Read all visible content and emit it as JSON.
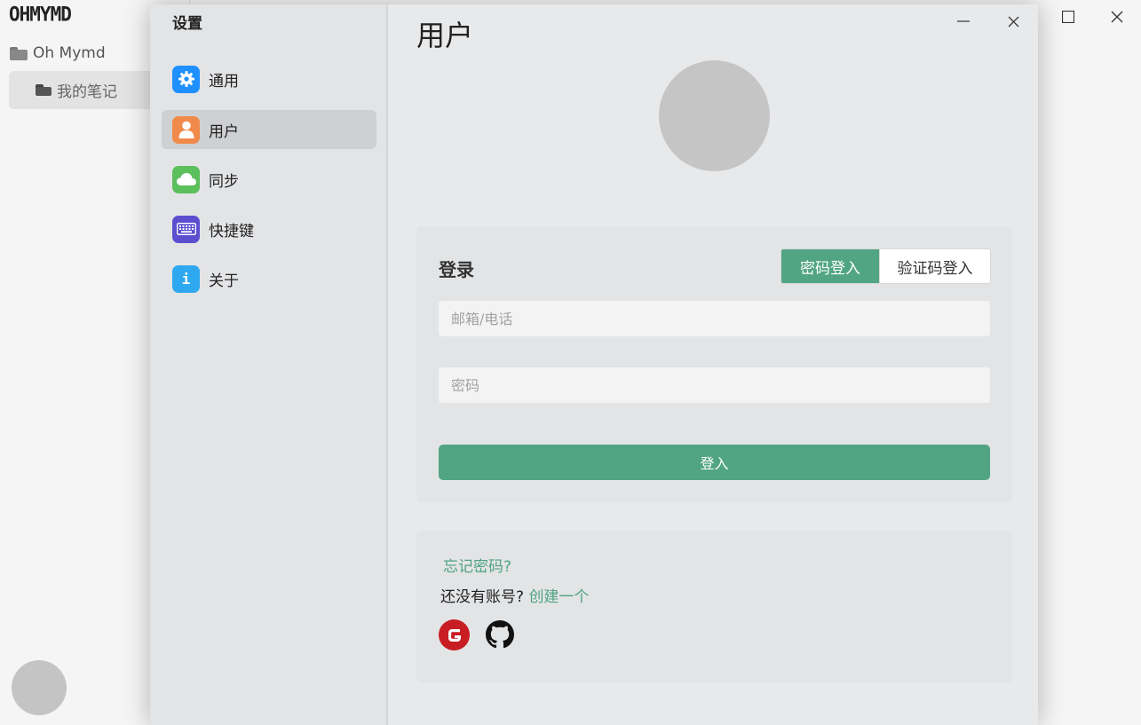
{
  "app": {
    "logo": "OHMYMD",
    "tree": {
      "root_label": "Oh Mymd",
      "child_label": "我的笔记"
    }
  },
  "dialog": {
    "title": "设置",
    "nav": [
      {
        "label": "通用",
        "icon": "gear-icon",
        "color": "#1e90ff"
      },
      {
        "label": "用户",
        "icon": "user-icon",
        "color": "#f08a4b"
      },
      {
        "label": "同步",
        "icon": "cloud-icon",
        "color": "#5bbf5b"
      },
      {
        "label": "快捷键",
        "icon": "keyboard-icon",
        "color": "#5b4fd0"
      },
      {
        "label": "关于",
        "icon": "info-icon",
        "color": "#2ea8f0"
      }
    ],
    "active_nav": "用户"
  },
  "user_page": {
    "title": "用户",
    "login": {
      "heading": "登录",
      "tabs": [
        "密码登入",
        "验证码登入"
      ],
      "active_tab": "密码登入",
      "email_placeholder": "邮箱/电话",
      "password_placeholder": "密码",
      "submit_label": "登入"
    },
    "extras": {
      "forgot_label": "忘记密码?",
      "no_account_label": "还没有账号?",
      "create_label": "创建一个",
      "social": [
        "gitee-icon",
        "github-icon"
      ]
    }
  },
  "colors": {
    "accent": "#51a583",
    "link": "#4fa380"
  }
}
